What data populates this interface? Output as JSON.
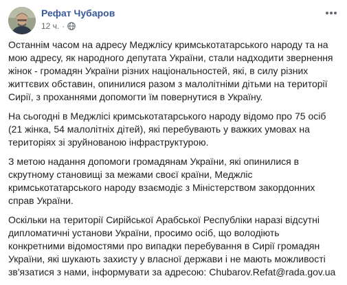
{
  "post": {
    "author": "Рефат Чубаров",
    "time": "12 ч.",
    "separator": "·",
    "privacy_icon": "globe-icon",
    "more_icon": "ellipsis-icon",
    "paragraphs": [
      "Останнім часом на адресу Меджлісу кримськотатарського народу та на мою адресу, як народного депутата України, стали надходити звернення жінок - громадян України різних національностей, які, в силу різних життєвих обставин, опинилися разом з малолітніми дітьми на території Сирії, з проханнями допомогти їм повернутися в Україну.",
      "На сьогодні в Меджлісі кримськотатарського народу відомо про 75 осіб (21 жінка, 54 малолітніх дітей), які перебувають у важких умовах на територіях зі зруйнованою інфраструктурою.",
      "З метою надання допомоги громадянам України, які опинилися в скрутному становищі за межами своєї країни, Меджліс кримськотатарського народу взаємодіє з Міністерством закордонних справ України."
    ],
    "last_paragraph_text": "Оскільки на території Сирійської Арабської Республіки наразі відсутні дипломатичні установи України, просимо осіб, що володіють конкретними відомостями про випадки перебування в Сирії громадян України, які шукають захисту у власної держави і не мають можливості зв'язатися з нами, інформувати за адресою: ",
    "email": "Chubarov.Refat@rada.gov.ua"
  }
}
